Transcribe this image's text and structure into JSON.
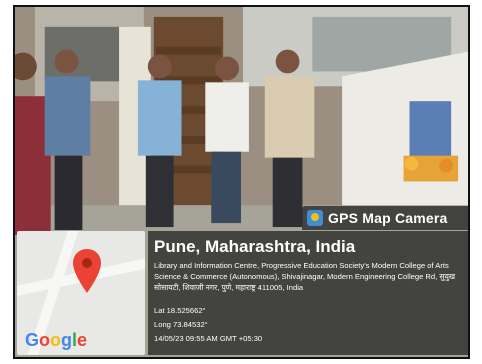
{
  "photo": {
    "icon": "event-photo"
  },
  "map": {
    "icon": "map-pin-icon",
    "logo_text": "Google",
    "logo_colors": [
      "#4285F4",
      "#EA4335",
      "#FBBC05",
      "#4285F4",
      "#34A853",
      "#EA4335"
    ]
  },
  "badge": {
    "label": "GPS Map Camera",
    "icon": "camera-app-icon"
  },
  "info": {
    "place": "Pune, Maharashtra, India",
    "address": "Library and Information Centre, Progressive Education Society's Modern College of Arts Science & Commerce (Autonomous), Shivajinagar, Modern Engineering College Rd, सुयुख सोसायटी, शिवाजी नगर, पुणे, महाराष्ट्र 411005, India",
    "lat": "Lat 18.525662°",
    "long": "Long 73.84532°",
    "timestamp": "14/05/23 09:55 AM GMT +05:30"
  }
}
